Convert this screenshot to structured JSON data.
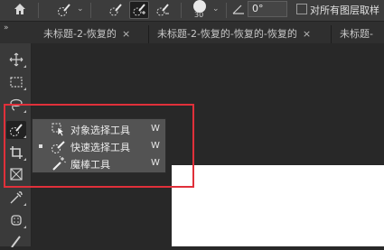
{
  "options_bar": {
    "brush_size": "30",
    "angle_value": "0°",
    "sample_all_layers_label": "对所有图层取样"
  },
  "tabs": [
    {
      "title": "未标题-2-恢复的",
      "close": "×"
    },
    {
      "title": "未标题-2-恢复的-恢复的-恢复的",
      "close": "×"
    },
    {
      "title": "未标题-"
    }
  ],
  "collapse_glyph": "»",
  "toolbar_tools": [
    "move-tool",
    "marquee-tool",
    "lasso-tool",
    "quick-selection-tool",
    "crop-tool",
    "frame-tool",
    "eyedropper-tool",
    "spot-healing-tool",
    "brush-tool"
  ],
  "flyout": {
    "items": [
      {
        "label": "对象选择工具",
        "shortcut": "W",
        "icon": "object-selection-icon",
        "selected": false
      },
      {
        "label": "快速选择工具",
        "shortcut": "W",
        "icon": "quick-selection-icon",
        "selected": true
      },
      {
        "label": "魔棒工具",
        "shortcut": "W",
        "icon": "magic-wand-icon",
        "selected": false
      }
    ]
  },
  "colors": {
    "annotation_box": "#e0303a",
    "panel_bg": "#3a3a3a",
    "flyout_bg": "#535353",
    "canvas": "#ffffff"
  }
}
